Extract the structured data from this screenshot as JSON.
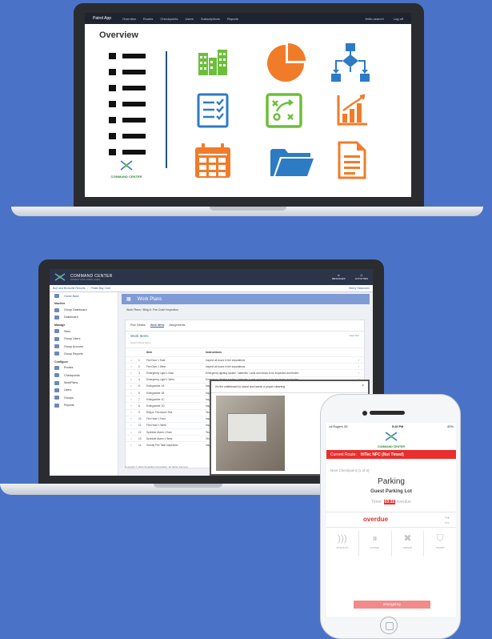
{
  "overview_laptop": {
    "nav": {
      "brand": "Patrol App",
      "items": [
        "Overview",
        "Routes",
        "Checkpoints",
        "Users",
        "Subscriptions",
        "Reports"
      ],
      "right": [
        "Hello search!",
        "Log off"
      ]
    },
    "title": "Overview",
    "logo_text": "COMMAND CENTER",
    "icons": [
      "buildings-icon",
      "pie-chart-icon",
      "flowchart-icon",
      "checklist-icon",
      "strategy-board-icon",
      "bar-chart-icon",
      "calendar-icon",
      "folder-icon",
      "document-icon"
    ],
    "colors": {
      "green": "#6cbf3a",
      "orange": "#f07c2a",
      "blue": "#2d7bc4",
      "navy": "#24517a"
    }
  },
  "workplans_laptop": {
    "brand": "COMMAND CENTER",
    "brand_sub": "OPERATIONS SIMPLIFIED",
    "top_right": [
      "MESSAGES",
      "ACTIVITIES"
    ],
    "breadcrumb": [
      "Burl and Brownlie Resorts",
      "Pirate Bay Club"
    ],
    "user": "Henry Halvorsen",
    "sidebar": {
      "home": "Home Base",
      "sections": [
        {
          "header": "Monitor",
          "items": [
            "Group Dashboard",
            "Dashboard"
          ]
        },
        {
          "header": "Manage",
          "items": [
            "Sites",
            "Group Users",
            "Group Account",
            "Group Reports"
          ]
        },
        {
          "header": "Configure",
          "items": [
            "Routes",
            "Checkpoints",
            "WorkPlans",
            "Users",
            "Groups",
            "Reports"
          ]
        }
      ]
    },
    "page_title": "Work Plans",
    "subtitle": "Work Plans / Bldg A: Fire Code Inspection",
    "tabs": [
      "Plan Details",
      "Work Items",
      "Assignments"
    ],
    "work_items_title": "Work Items",
    "new_sort": "New Sort",
    "search_placeholder": "Search Work Items",
    "columns": [
      "Item",
      "Instructions"
    ],
    "rows": [
      {
        "n": "1",
        "name": "Fire Door 1 East",
        "ins": "Inspect all doors in the separations"
      },
      {
        "n": "2",
        "name": "Fire Door 1 West",
        "ins": "Inspect all doors in the separations"
      },
      {
        "n": "3",
        "name": "Emergency Light 1 East",
        "ins": "Emergency lighting system / batteries / units and lamps to be inspected and tested"
      },
      {
        "n": "4",
        "name": "Emergency Light 1 West",
        "ins": "Emergency lighting system / batteries / units and lamps to be inspected and tested"
      },
      {
        "n": "5",
        "name": "Extinguisher 1A",
        "ins": "Inspect"
      },
      {
        "n": "6",
        "name": "Extinguisher 1B",
        "ins": "Inspect"
      },
      {
        "n": "7",
        "name": "Extinguisher 1C",
        "ins": "Inspect"
      },
      {
        "n": "8",
        "name": "Extinguisher 1D",
        "ins": "Inspect"
      },
      {
        "n": "9",
        "name": "Bldg A: Fire Alarm Test",
        "ins": "Test the"
      },
      {
        "n": "10",
        "name": "Fire Hose 1 East",
        "ins": "Inspect"
      },
      {
        "n": "11",
        "name": "Fire Hose 1 West",
        "ins": "Inspect"
      },
      {
        "n": "12",
        "name": "Sprinkler Alarm 1 East",
        "ins": "Test the"
      },
      {
        "n": "13",
        "name": "Sprinkler Alarm 1 West",
        "ins": "Test the"
      },
      {
        "n": "14",
        "name": "Gravity Fire Tank Inspection",
        "ins": "Inspect"
      }
    ],
    "modal_text": "It's the whiteboard to stand and needs a proper cleaning",
    "footer": "Copyright © 2016 Sendality Corporation. All rights reserved"
  },
  "phone": {
    "status": {
      "carrier": "••ll Rogers 3G",
      "time": "5:26 PM",
      "battery": "80%"
    },
    "logo_text": "COMMAND CENTER",
    "route_label": "Current Route:",
    "route_value": "HiTec NFC (Not Timed)",
    "next_checkpoint": "Next Checkpoint (1 of 3)",
    "checkpoint_name": "Parking",
    "checkpoint_location": "Guest Parking Lot",
    "timer_label": "Timer:",
    "timer_value": "03:32",
    "timer_suffix": "overdue",
    "status_text": "overdue",
    "forward_label": "skip",
    "actions": [
      "check-in",
      "pause",
      "cancel",
      "report"
    ],
    "emergency": "emergency",
    "colors": {
      "alert": "#ea2d2d"
    }
  }
}
